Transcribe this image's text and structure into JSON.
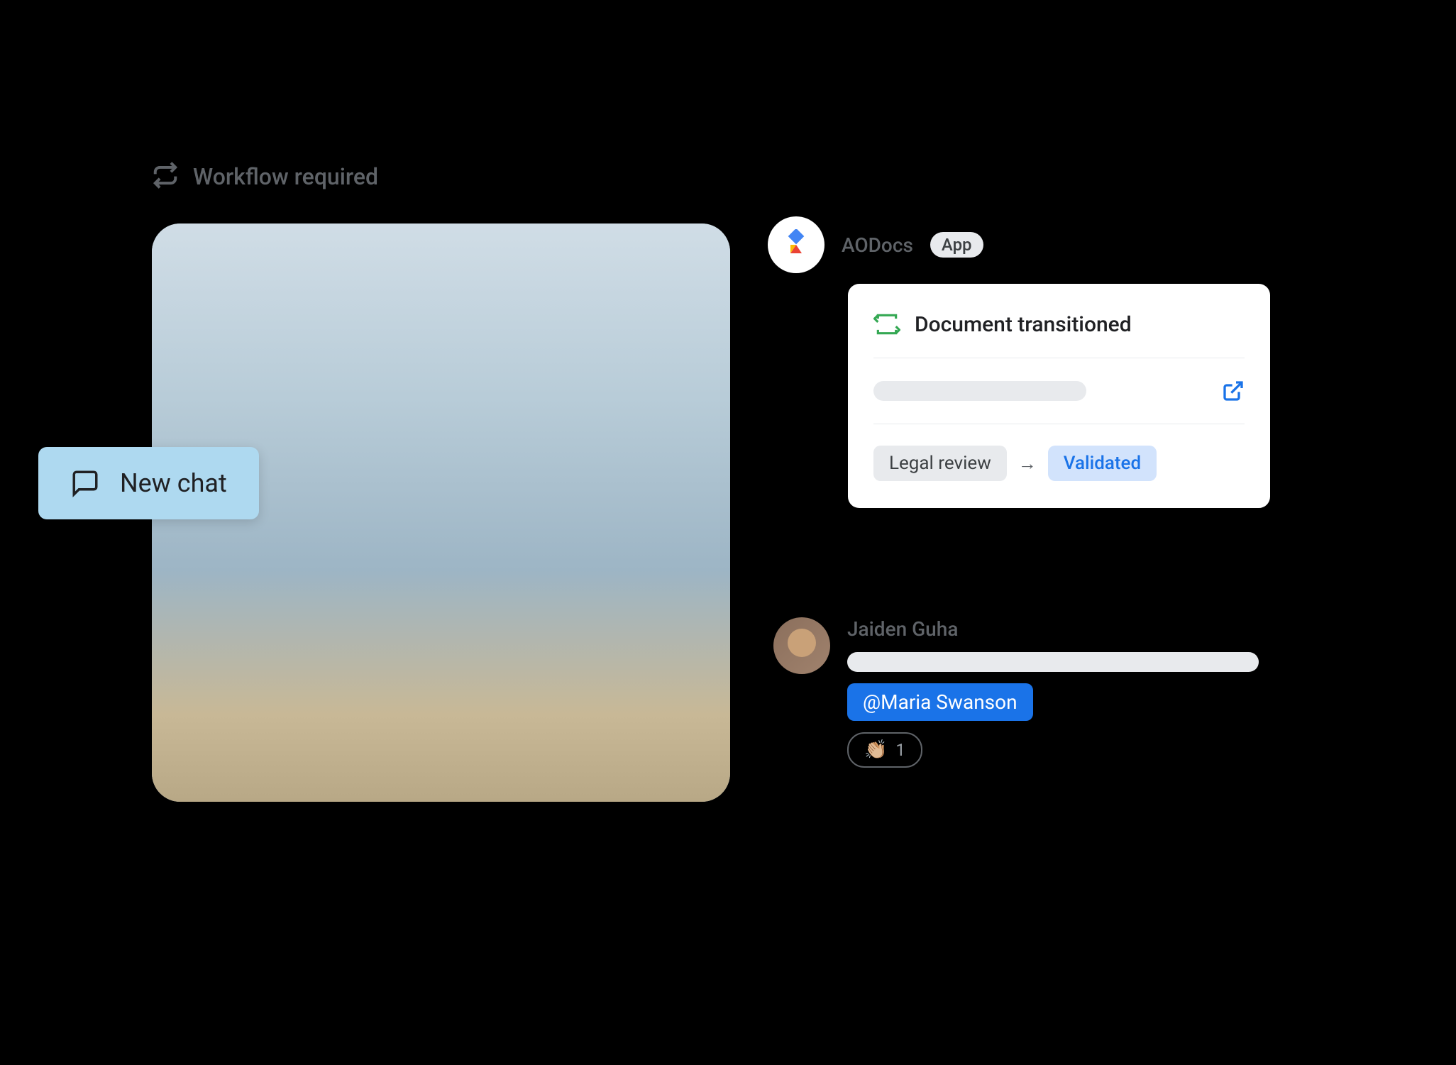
{
  "header": {
    "workflow_label": "Workflow required"
  },
  "new_chat": {
    "label": "New chat"
  },
  "aodocs": {
    "name": "AODocs",
    "badge": "App"
  },
  "document_card": {
    "title": "Document transitioned",
    "from_status": "Legal review",
    "to_status": "Validated"
  },
  "user_message": {
    "name": "Jaiden Guha",
    "mention": "@Maria Swanson",
    "reaction_emoji": "👏🏼",
    "reaction_count": "1"
  }
}
